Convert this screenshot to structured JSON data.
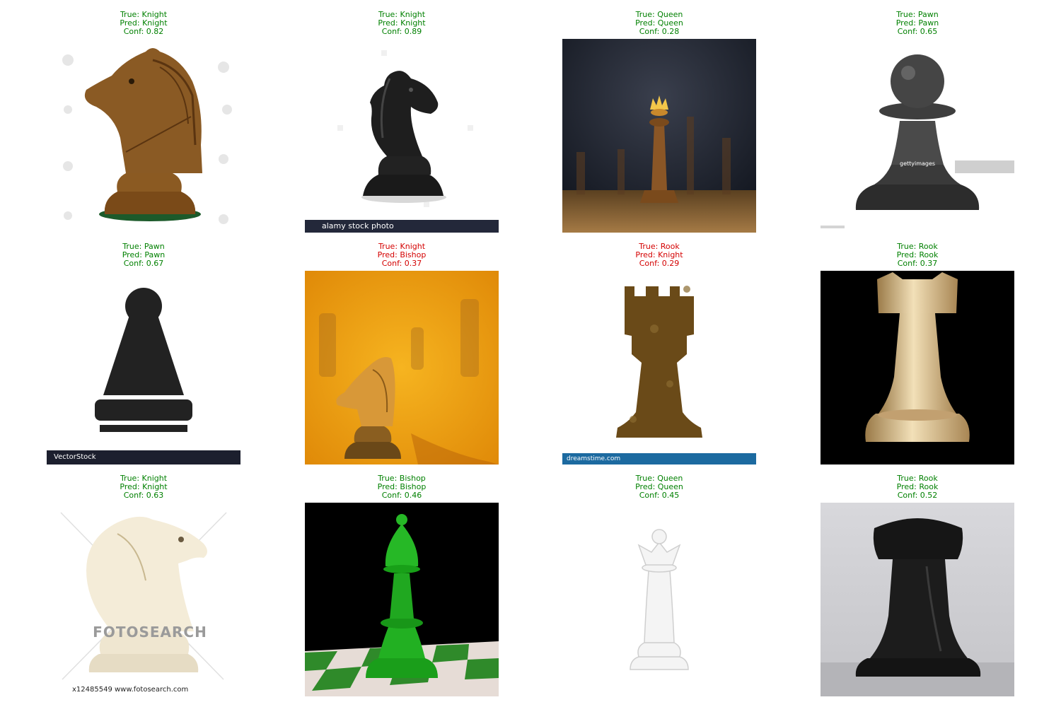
{
  "colors": {
    "correct": "#008000",
    "incorrect": "#d40000"
  },
  "grid": [
    {
      "true_label": "True: Knight",
      "pred_label": "Pred: Knight",
      "conf_label": "Conf: 0.82",
      "correct": true,
      "piece": "knight",
      "subject": "brown wooden chess knight",
      "watermark": ""
    },
    {
      "true_label": "True: Knight",
      "pred_label": "Pred: Knight",
      "conf_label": "Conf: 0.89",
      "correct": true,
      "piece": "knight",
      "subject": "black chess knight",
      "watermark": "alamy stock photo"
    },
    {
      "true_label": "True: Queen",
      "pred_label": "Pred: Queen",
      "conf_label": "Conf: 0.28",
      "correct": true,
      "piece": "queen",
      "subject": "wooden queen on dark chessboard",
      "watermark": ""
    },
    {
      "true_label": "True: Pawn",
      "pred_label": "Pred: Pawn",
      "conf_label": "Conf: 0.65",
      "correct": true,
      "piece": "pawn",
      "subject": "dark metallic pawn",
      "watermark": "gettyimages"
    },
    {
      "true_label": "True: Pawn",
      "pred_label": "Pred: Pawn",
      "conf_label": "Conf: 0.67",
      "correct": true,
      "piece": "pawn",
      "subject": "black pawn silhouette",
      "watermark": "VectorStock"
    },
    {
      "true_label": "True: Knight",
      "pred_label": "Pred: Bishop",
      "conf_label": "Conf: 0.37",
      "correct": false,
      "piece": "knight",
      "subject": "amber glass knight",
      "watermark": ""
    },
    {
      "true_label": "True: Rook",
      "pred_label": "Pred: Knight",
      "conf_label": "Conf: 0.29",
      "correct": false,
      "piece": "rook",
      "subject": "brown rook illustration",
      "watermark": "dreamstime.com"
    },
    {
      "true_label": "True: Rook",
      "pred_label": "Pred: Rook",
      "conf_label": "Conf: 0.37",
      "correct": true,
      "piece": "rook",
      "subject": "gold rook on black",
      "watermark": ""
    },
    {
      "true_label": "True: Knight",
      "pred_label": "Pred: Knight",
      "conf_label": "Conf: 0.63",
      "correct": true,
      "piece": "knight",
      "subject": "white chess knight",
      "watermark": "FOTOSEARCH",
      "watermark2": "x12485549  www.fotosearch.com"
    },
    {
      "true_label": "True: Bishop",
      "pred_label": "Pred: Bishop",
      "conf_label": "Conf: 0.46",
      "correct": true,
      "piece": "bishop",
      "subject": "green bishop on checkered board",
      "watermark": ""
    },
    {
      "true_label": "True: Queen",
      "pred_label": "Pred: Queen",
      "conf_label": "Conf: 0.45",
      "correct": true,
      "piece": "queen",
      "subject": "white queen",
      "watermark": ""
    },
    {
      "true_label": "True: Rook",
      "pred_label": "Pred: Rook",
      "conf_label": "Conf: 0.52",
      "correct": true,
      "piece": "rook",
      "subject": "black rook photo",
      "watermark": ""
    }
  ]
}
